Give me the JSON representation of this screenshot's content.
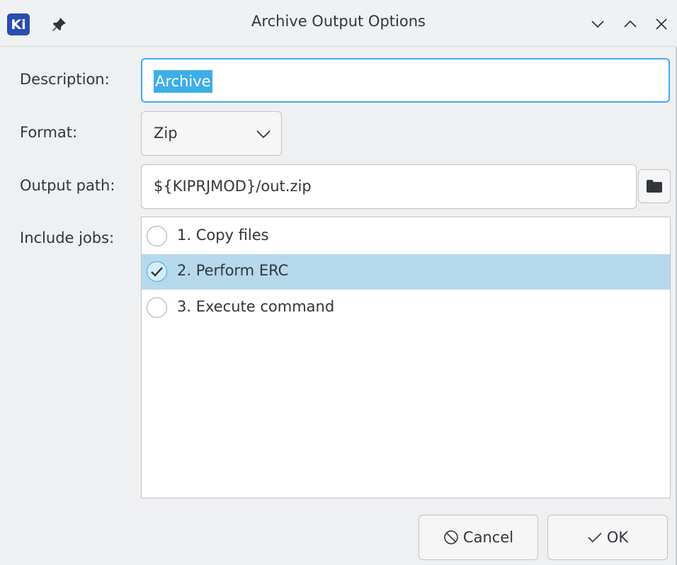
{
  "window": {
    "title": "Archive Output Options",
    "app_icon_text": "Ki"
  },
  "form": {
    "description_label": "Description:",
    "description_value": "Archive",
    "format_label": "Format:",
    "format_value": "Zip",
    "output_path_label": "Output path:",
    "output_path_value": "${KIPRJMOD}/out.zip",
    "include_jobs_label": "Include jobs:"
  },
  "jobs": [
    {
      "label": "1.  Copy files",
      "checked": false,
      "selected": false
    },
    {
      "label": "2.  Perform ERC",
      "checked": true,
      "selected": true
    },
    {
      "label": "3.  Execute command",
      "checked": false,
      "selected": false
    }
  ],
  "buttons": {
    "cancel_label": "Cancel",
    "ok_label": "OK"
  },
  "colors": {
    "accent": "#3daee9",
    "selection": "#b6d9ec",
    "window_bg": "#eff0f1",
    "app_icon": "#2a4bb0"
  },
  "icons": {
    "app": "kicad-app-icon",
    "pin": "pin-icon",
    "minimize": "chevron-down-icon",
    "maximize": "chevron-up-icon",
    "close": "close-icon",
    "dropdown": "chevron-down-icon",
    "folder": "folder-icon",
    "cancel": "cancel-icon",
    "ok": "checkmark-icon"
  }
}
